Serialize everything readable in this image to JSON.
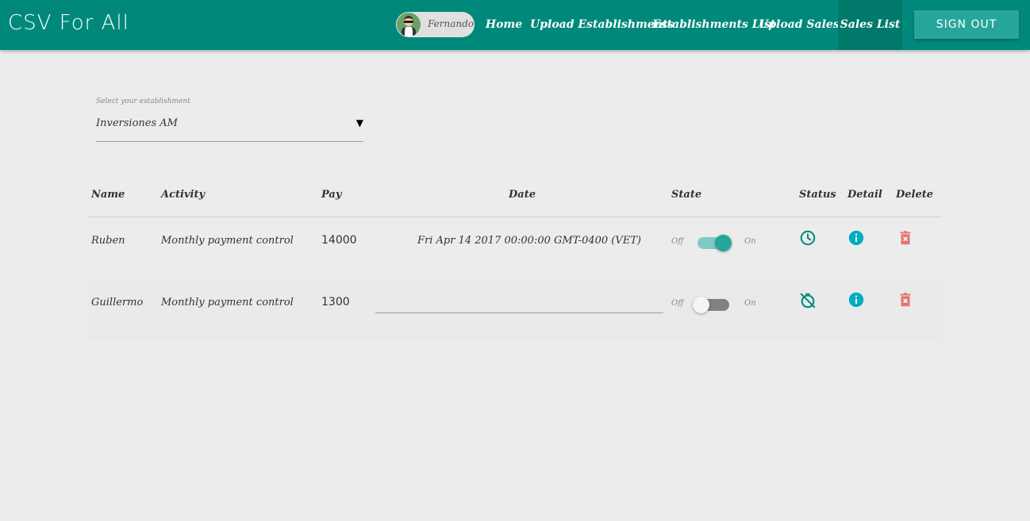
{
  "app": {
    "title": "CSV For All"
  },
  "user": {
    "name": "Fernando"
  },
  "nav": {
    "home": "Home",
    "upload_establishments": "Upload Establishments",
    "establishments_list": "Establishments List",
    "upload_sales": "Upload Sales",
    "sales_list": "Sales List",
    "sign_out": "SIGN OUT"
  },
  "establishment_select": {
    "label": "Select your establishment",
    "value": "Inversiones AM",
    "arrow": "▼"
  },
  "table": {
    "headers": {
      "name": "Name",
      "activity": "Activity",
      "pay": "Pay",
      "date": "Date",
      "state": "State",
      "status": "Status",
      "detail": "Detail",
      "delete": "Delete"
    },
    "switch_labels": {
      "off": "Off",
      "on": "On"
    },
    "rows": [
      {
        "name": "Ruben",
        "activity": "Monthly payment control",
        "pay": "14000",
        "date": "Fri Apr 14 2017 00:00:00 GMT-0400 (VET)",
        "state": true,
        "status_icon": "clock-icon"
      },
      {
        "name": "Guillermo",
        "activity": "Monthly payment control",
        "pay": "1300",
        "date": "",
        "state": false,
        "status_icon": "timer-off-icon"
      }
    ]
  },
  "colors": {
    "primary": "#00897b",
    "primary_dark": "#00796b",
    "accent": "#26a69a",
    "info": "#00acc1",
    "delete": "#e57373",
    "background": "#ececec"
  }
}
